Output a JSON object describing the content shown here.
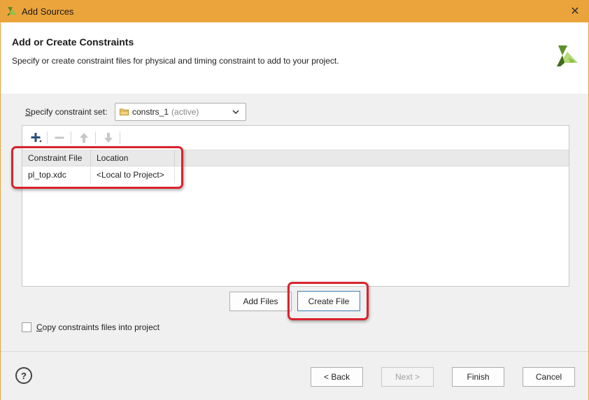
{
  "window": {
    "title": "Add Sources",
    "close_glyph": "✕"
  },
  "header": {
    "title": "Add or Create Constraints",
    "description": "Specify or create constraint files for physical and timing constraint to add to your project."
  },
  "constraint_set": {
    "label_prefix": "S",
    "label_rest": "pecify constraint set:",
    "value": "constrs_1",
    "status": "(active)"
  },
  "table": {
    "columns": [
      "Constraint File",
      "Location"
    ],
    "rows": [
      {
        "file": "pl_top.xdc",
        "location": "<Local to Project>"
      }
    ]
  },
  "buttons": {
    "add_files": "Add Files",
    "create_file": "Create File"
  },
  "copy_option": {
    "label_prefix": "C",
    "label_rest": "opy constraints files into project",
    "checked": false
  },
  "footer": {
    "help": "?",
    "back": "< Back",
    "next": "Next >",
    "finish": "Finish",
    "cancel": "Cancel"
  },
  "colors": {
    "titlebar": "#eba43b",
    "highlight": "#d9232d",
    "logo_green": "#7ab648"
  },
  "icons": [
    "vivado-logo-icon",
    "close-icon",
    "folder-icon",
    "chevron-down-icon",
    "add-icon",
    "remove-icon",
    "move-up-icon",
    "move-down-icon",
    "help-icon"
  ]
}
